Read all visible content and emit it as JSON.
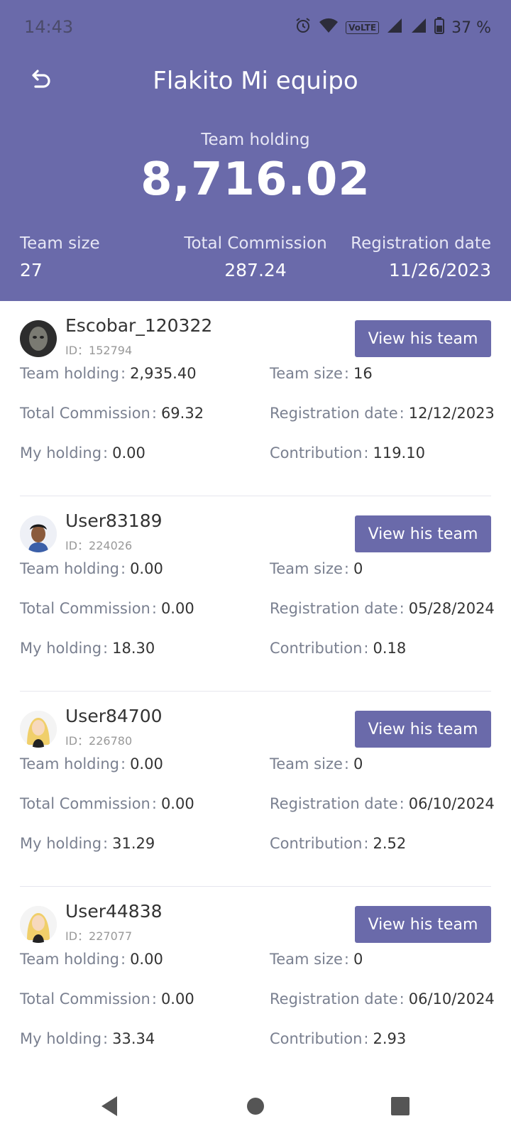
{
  "status_bar": {
    "time": "14:43",
    "battery": "37 %",
    "network": "VoLTE"
  },
  "header": {
    "title": "Flakito Mi equipo",
    "holding_label": "Team holding",
    "holding_value": "8,716.02",
    "stats": [
      {
        "label": "Team size",
        "value": "27"
      },
      {
        "label": "Total Commission",
        "value": "287.24"
      },
      {
        "label": "Registration date",
        "value": "11/26/2023"
      }
    ]
  },
  "labels": {
    "team_holding": "Team holding",
    "team_size": "Team size",
    "total_commission": "Total Commission",
    "registration_date": "Registration date",
    "my_holding": "My holding",
    "contribution": "Contribution",
    "separator": ":",
    "view_team": "View his team"
  },
  "members": [
    {
      "name": "Escobar_120322",
      "id": "ID：152794",
      "team_holding": "2,935.40",
      "team_size": "16",
      "total_commission": "69.32",
      "registration_date": "12/12/2023",
      "my_holding": "0.00",
      "contribution": "119.10"
    },
    {
      "name": "User83189",
      "id": "ID：224026",
      "team_holding": "0.00",
      "team_size": "0",
      "total_commission": "0.00",
      "registration_date": "05/28/2024",
      "my_holding": "18.30",
      "contribution": "0.18"
    },
    {
      "name": "User84700",
      "id": "ID：226780",
      "team_holding": "0.00",
      "team_size": "0",
      "total_commission": "0.00",
      "registration_date": "06/10/2024",
      "my_holding": "31.29",
      "contribution": "2.52"
    },
    {
      "name": "User44838",
      "id": "ID：227077",
      "team_holding": "0.00",
      "team_size": "0",
      "total_commission": "0.00",
      "registration_date": "06/10/2024",
      "my_holding": "33.34",
      "contribution": "2.93"
    }
  ],
  "colors": {
    "primary": "#6a6aaa",
    "label": "#7a8090",
    "value": "#333333",
    "divider": "#e6e6ee"
  }
}
